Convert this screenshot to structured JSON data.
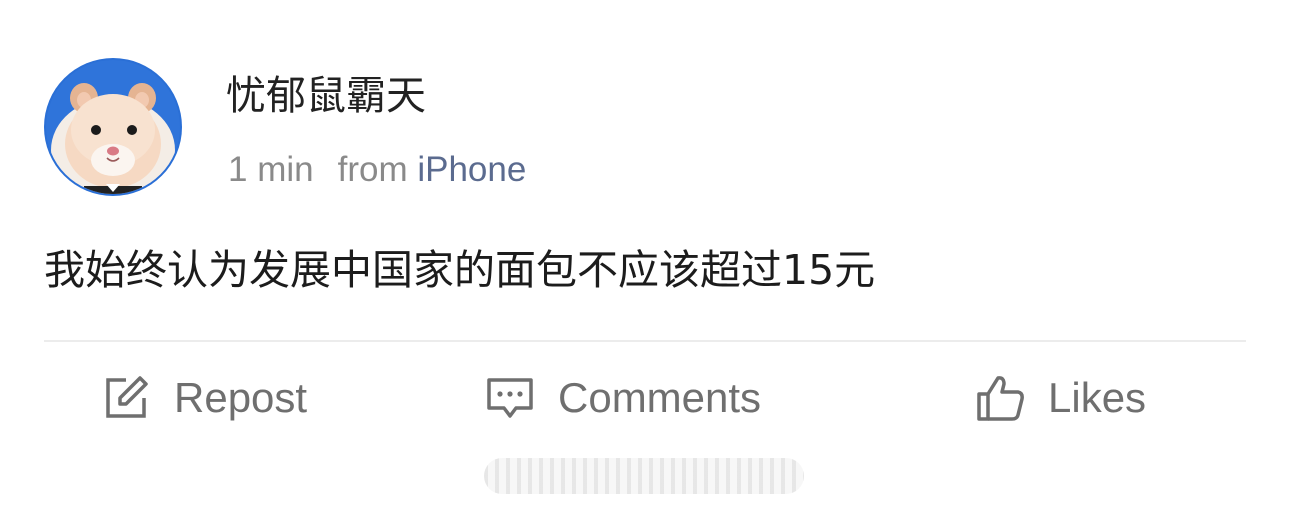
{
  "post": {
    "user": {
      "name": "忧郁鼠霸天",
      "avatar_icon": "hamster-avatar-icon"
    },
    "meta": {
      "time": "1 min",
      "from_prefix": "from",
      "source": "iPhone"
    },
    "content": "我始终认为发展中国家的面包不应该超过15元"
  },
  "actions": {
    "repost": {
      "label": "Repost",
      "icon": "edit-icon"
    },
    "comments": {
      "label": "Comments",
      "icon": "comment-icon"
    },
    "likes": {
      "label": "Likes",
      "icon": "thumbs-up-icon"
    }
  },
  "colors": {
    "text": "#1c1c1c",
    "meta": "#8a8a8a",
    "source_link": "#5b6b8f",
    "action": "#6f6f6f",
    "divider": "#ececec",
    "avatar_ring": "#2a6fd6"
  }
}
